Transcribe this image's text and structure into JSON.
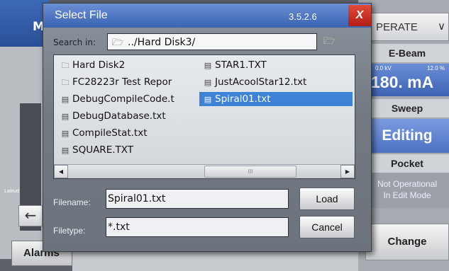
{
  "background": {
    "header_letter": "M",
    "latitude_label": "Latitud",
    "back_arrow": "←",
    "alarms_label": "Alarms"
  },
  "right_panel": {
    "operate_label": "PERATE",
    "operate_chevron": "∨",
    "ebeam_label": "E-Beam",
    "kv_value": "0.0 kV",
    "percent_value": "12.0 %",
    "ma_value": "180. mA",
    "sweep_label": "Sweep",
    "editing_label": "Editing",
    "pocket_label": "Pocket",
    "pocket_status_line1": "Not Operational",
    "pocket_status_line2": "In Edit Mode",
    "change_label": "Change"
  },
  "dialog": {
    "title": "Select File",
    "version": "3.5.2.6",
    "close_label": "X",
    "search_label": "Search in:",
    "search_path": "../Hard Disk3/",
    "files": [
      {
        "name": "Hard Disk2",
        "kind": "folder",
        "selected": false
      },
      {
        "name": "FC28223r Test Repor",
        "kind": "folder",
        "selected": false
      },
      {
        "name": "DebugCompileCode.t",
        "kind": "file",
        "selected": false
      },
      {
        "name": "DebugDatabase.txt",
        "kind": "file",
        "selected": false
      },
      {
        "name": "CompileStat.txt",
        "kind": "file",
        "selected": false
      },
      {
        "name": "SQUARE.TXT",
        "kind": "file",
        "selected": false
      },
      {
        "name": "STAR1.TXT",
        "kind": "file",
        "selected": false
      },
      {
        "name": "JustAcoolStar12.txt",
        "kind": "file",
        "selected": false
      },
      {
        "name": "Spiral01.txt",
        "kind": "file",
        "selected": true
      }
    ],
    "scroll_thumb_grip": "III",
    "filename_label": "Filename:",
    "filename_value": "Spiral01.txt",
    "filetype_label": "Filetype:",
    "filetype_value": "*.txt",
    "load_label": "Load",
    "cancel_label": "Cancel"
  }
}
